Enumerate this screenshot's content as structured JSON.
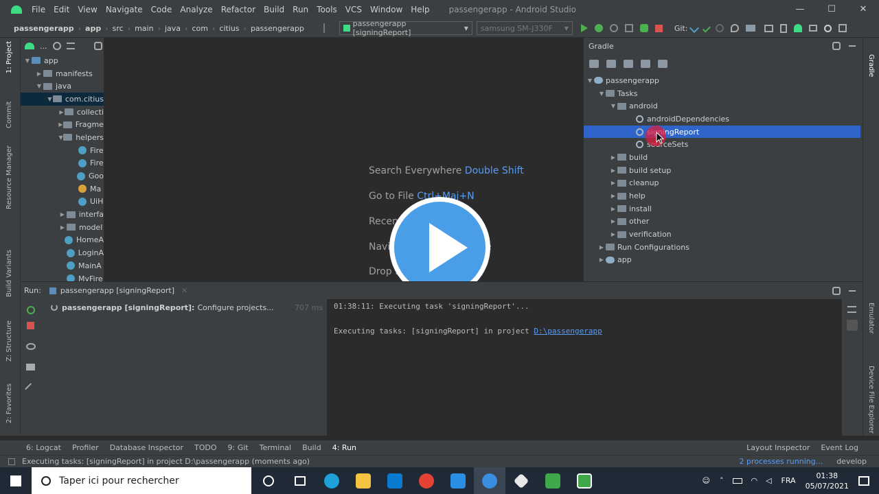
{
  "window": {
    "title": "passengerapp - Android Studio",
    "controls": [
      "—",
      "☐",
      "✕"
    ]
  },
  "menu": [
    "File",
    "Edit",
    "View",
    "Navigate",
    "Code",
    "Analyze",
    "Refactor",
    "Build",
    "Run",
    "Tools",
    "VCS",
    "Window",
    "Help"
  ],
  "breadcrumbs": [
    "passengerapp",
    "app",
    "src",
    "main",
    "java",
    "com",
    "citius",
    "passengerapp"
  ],
  "run_config": "passengerapp [signingReport]",
  "device": "samsung SM-J330F",
  "git_label": "Git:",
  "side_left": [
    "1: Project",
    "Commit",
    "Resource Manager",
    "Build Variants",
    "Z: Structure",
    "2: Favorites"
  ],
  "side_right": [
    "Gradle",
    "Emulator",
    "Device File Explorer"
  ],
  "project_tree": [
    {
      "label": "app",
      "depth": 0,
      "arrow": "▼",
      "kind": "folder"
    },
    {
      "label": "manifests",
      "depth": 1,
      "arrow": "▶",
      "kind": "folder"
    },
    {
      "label": "java",
      "depth": 1,
      "arrow": "▼",
      "kind": "folder"
    },
    {
      "label": "com.citius",
      "depth": 2,
      "arrow": "▼",
      "kind": "folder",
      "selected": true
    },
    {
      "label": "collecti",
      "depth": 3,
      "arrow": "▶",
      "kind": "folder"
    },
    {
      "label": "Fragme",
      "depth": 3,
      "arrow": "▶",
      "kind": "folder"
    },
    {
      "label": "helpers",
      "depth": 3,
      "arrow": "▼",
      "kind": "folder"
    },
    {
      "label": "Fire",
      "depth": 4,
      "arrow": "",
      "kind": "class"
    },
    {
      "label": "Fire",
      "depth": 4,
      "arrow": "",
      "kind": "class"
    },
    {
      "label": "Goo",
      "depth": 4,
      "arrow": "",
      "kind": "class"
    },
    {
      "label": "Ma",
      "depth": 4,
      "arrow": "",
      "kind": "class"
    },
    {
      "label": "UiH",
      "depth": 4,
      "arrow": "",
      "kind": "class"
    },
    {
      "label": "interfa",
      "depth": 3,
      "arrow": "▶",
      "kind": "folder"
    },
    {
      "label": "model",
      "depth": 3,
      "arrow": "▶",
      "kind": "folder"
    },
    {
      "label": "HomeA",
      "depth": 3,
      "arrow": "",
      "kind": "class"
    },
    {
      "label": "LoginA",
      "depth": 3,
      "arrow": "",
      "kind": "class"
    },
    {
      "label": "MainA",
      "depth": 3,
      "arrow": "",
      "kind": "class"
    },
    {
      "label": "MyFire",
      "depth": 3,
      "arrow": "",
      "kind": "class"
    }
  ],
  "editor_hints": {
    "search_everywhere": "Search Everywhere",
    "search_key": "Double Shift",
    "goto_file": "Go to File",
    "goto_key": "Ctrl+Maj+N",
    "recent": "Recen",
    "navi": "Navi",
    "navi_tail": "e",
    "drop": "Drop f"
  },
  "gradle": {
    "title": "Gradle",
    "tree": [
      {
        "label": "passengerapp",
        "depth": 0,
        "arrow": "▼",
        "kind": "elephant"
      },
      {
        "label": "Tasks",
        "depth": 1,
        "arrow": "▼",
        "kind": "folder"
      },
      {
        "label": "android",
        "depth": 2,
        "arrow": "▼",
        "kind": "folder"
      },
      {
        "label": "androidDependencies",
        "depth": 3,
        "arrow": "",
        "kind": "gear"
      },
      {
        "label": "signingReport",
        "depth": 3,
        "arrow": "",
        "kind": "gear",
        "selected": true
      },
      {
        "label": "sourceSets",
        "depth": 3,
        "arrow": "",
        "kind": "gear"
      },
      {
        "label": "build",
        "depth": 2,
        "arrow": "▶",
        "kind": "folder"
      },
      {
        "label": "build setup",
        "depth": 2,
        "arrow": "▶",
        "kind": "folder"
      },
      {
        "label": "cleanup",
        "depth": 2,
        "arrow": "▶",
        "kind": "folder"
      },
      {
        "label": "help",
        "depth": 2,
        "arrow": "▶",
        "kind": "folder"
      },
      {
        "label": "install",
        "depth": 2,
        "arrow": "▶",
        "kind": "folder"
      },
      {
        "label": "other",
        "depth": 2,
        "arrow": "▶",
        "kind": "folder"
      },
      {
        "label": "verification",
        "depth": 2,
        "arrow": "▶",
        "kind": "folder"
      },
      {
        "label": "Run Configurations",
        "depth": 1,
        "arrow": "▶",
        "kind": "folder"
      },
      {
        "label": "app",
        "depth": 1,
        "arrow": "▶",
        "kind": "elephant"
      }
    ]
  },
  "run": {
    "label": "Run:",
    "tab": "passengerapp [signingReport]",
    "task_bold": "passengerapp [signingReport]:",
    "task_text": "Configure projects...",
    "task_time": "707 ms",
    "console_line1": "01:38:11: Executing task 'signingReport'...",
    "console_line2_prefix": "Executing tasks: [signingReport] in project ",
    "console_link": "D:\\passengerapp"
  },
  "bottom_tabs": [
    "6: Logcat",
    "Profiler",
    "Database Inspector",
    "TODO",
    "9: Git",
    "Terminal",
    "Build",
    "4: Run"
  ],
  "bottom_right_tabs": [
    "Layout Inspector",
    "Event Log"
  ],
  "status": {
    "message": "Executing tasks: [signingReport] in project D:\\passengerapp (moments ago)",
    "processes": "2 processes running...",
    "branch": "develop"
  },
  "taskbar": {
    "search_placeholder": "Taper ici pour rechercher",
    "lang": "FRA",
    "time": "01:38",
    "date": "05/07/2021"
  }
}
